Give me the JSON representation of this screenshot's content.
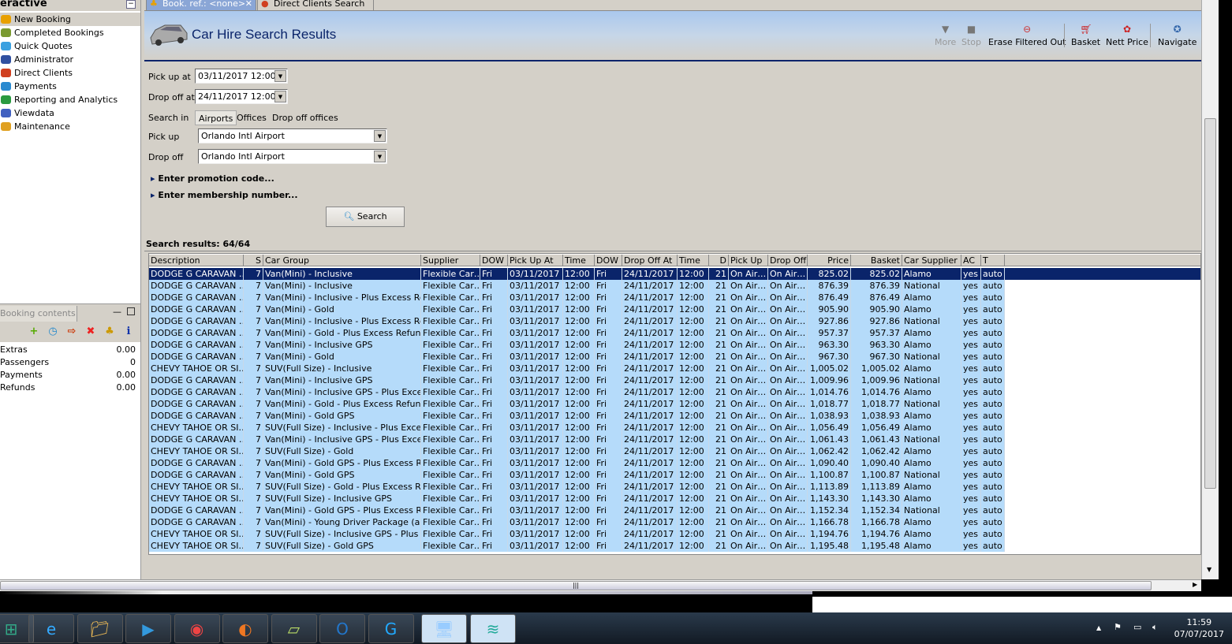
{
  "sidebar": {
    "title": "eractive",
    "items": [
      {
        "label": "New Booking",
        "icon": "palm-tree-icon",
        "color": "#e8a000"
      },
      {
        "label": "Completed Bookings",
        "icon": "palm-money-icon",
        "color": "#7a9a30"
      },
      {
        "label": "Quick Quotes",
        "icon": "clock-icon",
        "color": "#3aa0e0"
      },
      {
        "label": "Administrator",
        "icon": "running-man-icon",
        "color": "#3050a0"
      },
      {
        "label": "Direct Clients",
        "icon": "client-icon",
        "color": "#d04020"
      },
      {
        "label": "Payments",
        "icon": "dollar-icon",
        "color": "#2a8ad0"
      },
      {
        "label": "Reporting and Analytics",
        "icon": "report-icon",
        "color": "#2a9a40"
      },
      {
        "label": "Viewdata",
        "icon": "globe-icon",
        "color": "#4060c0"
      },
      {
        "label": "Maintenance",
        "icon": "tools-icon",
        "color": "#e0a020"
      }
    ]
  },
  "booking_contents": {
    "tab": "Booking contents",
    "rows": [
      {
        "label": "Extras",
        "value": "0.00"
      },
      {
        "label": "Passengers",
        "value": "0"
      },
      {
        "label": "Payments",
        "value": "0.00"
      },
      {
        "label": "Refunds",
        "value": "0.00"
      }
    ]
  },
  "tabs": [
    {
      "label": "Book. ref.: <none>",
      "active": true
    },
    {
      "label": "Direct Clients Search",
      "active": false
    }
  ],
  "header": {
    "title": "Car Hire Search Results"
  },
  "toolbar": [
    {
      "label": "More",
      "enabled": false
    },
    {
      "label": "Stop",
      "enabled": false
    },
    {
      "label": "Erase Filtered Out",
      "enabled": true
    },
    {
      "label": "Basket",
      "enabled": true
    },
    {
      "label": "Nett Price",
      "enabled": true
    },
    {
      "label": "Navigate",
      "enabled": true
    }
  ],
  "form": {
    "pickup_at_label": "Pick up at",
    "pickup_at": "03/11/2017 12:00",
    "dropoff_at_label": "Drop off at",
    "dropoff_at": "24/11/2017 12:00",
    "search_in_label": "Search in",
    "search_in_options": [
      "Airports",
      "Offices",
      "Drop off offices"
    ],
    "search_in_selected": "Airports",
    "pickup_label": "Pick up",
    "pickup": "Orlando Intl Airport",
    "dropoff_label": "Drop off",
    "dropoff": "Orlando Intl Airport",
    "promo": "Enter promotion code...",
    "membership": "Enter membership number...",
    "search_button": "Search"
  },
  "results": {
    "summary": "Search results: 64/64",
    "columns": [
      "Description",
      "S",
      "Car Group",
      "Supplier",
      "DOW",
      "Pick Up At",
      "Time",
      "DOW",
      "Drop Off At",
      "Time",
      "D",
      "Pick Up",
      "Drop Off",
      "Price",
      "Basket",
      "Car Supplier",
      "AC",
      "T"
    ],
    "common": {
      "seats": "7",
      "supplier": "Flexible Car…",
      "pu_dow": "Fri",
      "pu_date": "03/11/2017",
      "pu_time": "12:00",
      "do_dow": "Fri",
      "do_date": "24/11/2017",
      "do_time": "12:00",
      "days": "21",
      "pu_loc": "On Air…",
      "do_loc": "On Air…",
      "ac": "yes",
      "trans": "auto"
    },
    "rows": [
      [
        "DODGE G CARAVAN …",
        "Van(Mini) - Inclusive",
        "825.02",
        "Alamo"
      ],
      [
        "DODGE G CARAVAN …",
        "Van(Mini) - Inclusive",
        "876.39",
        "National"
      ],
      [
        "DODGE G CARAVAN …",
        "Van(Mini) - Inclusive - Plus Excess Ref…",
        "876.49",
        "Alamo"
      ],
      [
        "DODGE G CARAVAN …",
        "Van(Mini) - Gold",
        "905.90",
        "Alamo"
      ],
      [
        "DODGE G CARAVAN …",
        "Van(Mini) - Inclusive - Plus Excess Ref…",
        "927.86",
        "National"
      ],
      [
        "DODGE G CARAVAN …",
        "Van(Mini) - Gold - Plus Excess Refund",
        "957.37",
        "Alamo"
      ],
      [
        "DODGE G CARAVAN …",
        "Van(Mini) - Inclusive GPS",
        "963.30",
        "Alamo"
      ],
      [
        "DODGE G CARAVAN …",
        "Van(Mini) - Gold",
        "967.30",
        "National"
      ],
      [
        "CHEVY TAHOE OR SI…",
        "SUV(Full Size) - Inclusive",
        "1,005.02",
        "Alamo"
      ],
      [
        "DODGE G CARAVAN …",
        "Van(Mini) - Inclusive GPS",
        "1,009.96",
        "National"
      ],
      [
        "DODGE G CARAVAN …",
        "Van(Mini) - Inclusive GPS - Plus Exces…",
        "1,014.76",
        "Alamo"
      ],
      [
        "DODGE G CARAVAN …",
        "Van(Mini) - Gold - Plus Excess Refund",
        "1,018.77",
        "National"
      ],
      [
        "DODGE G CARAVAN …",
        "Van(Mini) - Gold GPS",
        "1,038.93",
        "Alamo"
      ],
      [
        "CHEVY TAHOE OR SI…",
        "SUV(Full Size) - Inclusive - Plus Excess…",
        "1,056.49",
        "Alamo"
      ],
      [
        "DODGE G CARAVAN …",
        "Van(Mini) - Inclusive GPS - Plus Exces…",
        "1,061.43",
        "National"
      ],
      [
        "CHEVY TAHOE OR SI…",
        "SUV(Full Size) - Gold",
        "1,062.42",
        "Alamo"
      ],
      [
        "DODGE G CARAVAN …",
        "Van(Mini) - Gold GPS - Plus Excess Ref…",
        "1,090.40",
        "Alamo"
      ],
      [
        "DODGE G CARAVAN …",
        "Van(Mini) - Gold GPS",
        "1,100.87",
        "National"
      ],
      [
        "CHEVY TAHOE OR SI…",
        "SUV(Full Size) - Gold - Plus Excess Ref…",
        "1,113.89",
        "Alamo"
      ],
      [
        "CHEVY TAHOE OR SI…",
        "SUV(Full Size) - Inclusive GPS",
        "1,143.30",
        "Alamo"
      ],
      [
        "DODGE G CARAVAN …",
        "Van(Mini) - Gold GPS - Plus Excess Ref…",
        "1,152.34",
        "National"
      ],
      [
        "DODGE G CARAVAN …",
        "Van(Mini) - Young Driver Package (ag…",
        "1,166.78",
        "Alamo"
      ],
      [
        "CHEVY TAHOE OR SI…",
        "SUV(Full Size) - Inclusive GPS - Plus E…",
        "1,194.76",
        "Alamo"
      ],
      [
        "CHEVY TAHOE OR SI…",
        "SUV(Full Size) - Gold GPS",
        "1,195.48",
        "Alamo"
      ]
    ]
  },
  "taskbar": {
    "apps": [
      "start-icon",
      "internet-explorer-icon",
      "file-explorer-icon",
      "media-player-icon",
      "chrome-icon",
      "firefox-icon",
      "sticky-notes-icon",
      "outlook-icon",
      "app-c-icon",
      "remote-desktop-icon",
      "app-layers-icon"
    ],
    "time": "11:59",
    "date": "07/07/2017"
  },
  "colors": {
    "selection": "#0a246a",
    "row": "#b5dbfa",
    "title": "#0a246a"
  }
}
